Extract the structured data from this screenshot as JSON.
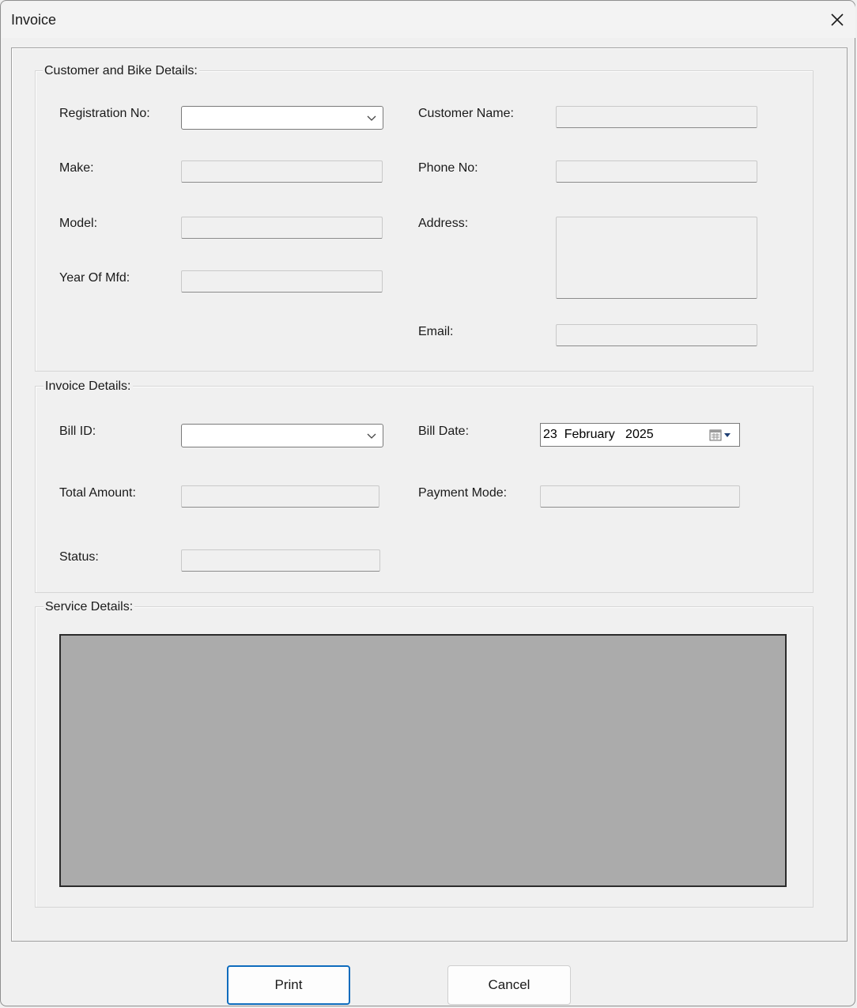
{
  "window": {
    "title": "Invoice"
  },
  "customer_group": {
    "legend": "Customer and Bike Details:",
    "registration_label": "Registration No:",
    "registration_value": "",
    "make_label": "Make:",
    "model_label": "Model:",
    "year_label": "Year Of Mfd:",
    "customer_name_label": "Customer Name:",
    "phone_label": "Phone No:",
    "address_label": "Address:",
    "email_label": "Email:"
  },
  "invoice_group": {
    "legend": "Invoice Details:",
    "bill_id_label": "Bill ID:",
    "bill_id_value": "",
    "bill_date_label": "Bill Date:",
    "bill_date_value": "23  February   2025",
    "total_amount_label": "Total Amount:",
    "payment_mode_label": "Payment Mode:",
    "status_label": "Status:"
  },
  "service_group": {
    "legend": "Service Details:"
  },
  "buttons": {
    "print": "Print",
    "cancel": "Cancel"
  }
}
